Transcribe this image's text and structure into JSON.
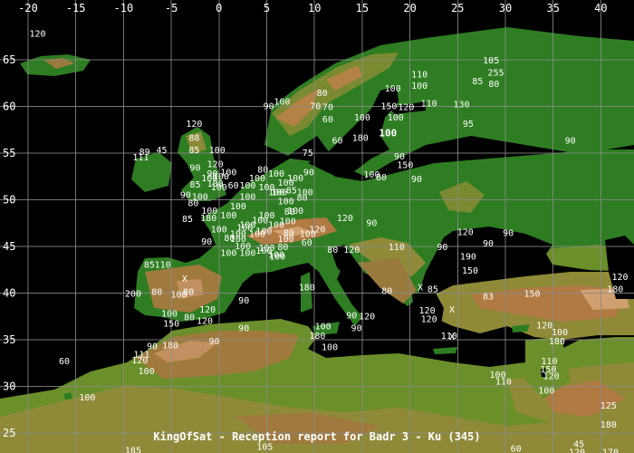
{
  "map": {
    "title": "KingOfSat - Reception report for Badr 3 - Ku (345)",
    "lon_ticks": [
      "-20",
      "-15",
      "-10",
      "-5",
      "0",
      "5",
      "10",
      "15",
      "20",
      "25",
      "30",
      "35",
      "40"
    ],
    "lat_ticks": [
      "65",
      "60",
      "55",
      "50",
      "45",
      "40",
      "35",
      "30",
      "25"
    ],
    "colors": {
      "sea": "#000000",
      "lowland": "#1f7a1f",
      "hill": "#6b8f2a",
      "highland": "#9c7b3a",
      "mountain": "#b07a4a",
      "peak": "#d0a070",
      "ice": "#e0e0e0",
      "grid": "#8a8a8a"
    },
    "reports": [
      {
        "v": "120",
        "lon": -19,
        "lat": 67.5
      },
      {
        "v": "105",
        "lon": 28.5,
        "lat": 64.6
      },
      {
        "v": "255",
        "lon": 29,
        "lat": 63.3
      },
      {
        "v": "110",
        "lon": 21,
        "lat": 63.1
      },
      {
        "v": "85",
        "lon": 27.1,
        "lat": 62.4
      },
      {
        "v": "80",
        "lon": 28.8,
        "lat": 62.1
      },
      {
        "v": "100",
        "lon": 18.2,
        "lat": 61.6
      },
      {
        "v": "100",
        "lon": 21,
        "lat": 61.9
      },
      {
        "v": "80",
        "lon": 10.8,
        "lat": 61.1
      },
      {
        "v": "100",
        "lon": 6.6,
        "lat": 60.2
      },
      {
        "v": "90",
        "lon": 5.2,
        "lat": 59.7
      },
      {
        "v": "70",
        "lon": 10.1,
        "lat": 59.7
      },
      {
        "v": "70",
        "lon": 11.4,
        "lat": 59.6
      },
      {
        "v": "150",
        "lon": 17.8,
        "lat": 59.7
      },
      {
        "v": "120",
        "lon": 19.6,
        "lat": 59.6
      },
      {
        "v": "110",
        "lon": 22,
        "lat": 60
      },
      {
        "v": "130",
        "lon": 25.4,
        "lat": 59.9
      },
      {
        "v": "60",
        "lon": 11.4,
        "lat": 58.3
      },
      {
        "v": "100",
        "lon": 15,
        "lat": 58.5
      },
      {
        "v": "100",
        "lon": 18.5,
        "lat": 58.5
      },
      {
        "v": "100",
        "lon": 17.7,
        "lat": 56.8,
        "b": 1
      },
      {
        "v": "95",
        "lon": 26.1,
        "lat": 57.8
      },
      {
        "v": "90",
        "lon": 36.8,
        "lat": 56
      },
      {
        "v": "120",
        "lon": -2.6,
        "lat": 57.8
      },
      {
        "v": "88",
        "lon": -2.6,
        "lat": 56.3
      },
      {
        "v": "60",
        "lon": 12.4,
        "lat": 56
      },
      {
        "v": "180",
        "lon": 14.8,
        "lat": 56.3
      },
      {
        "v": "89",
        "lon": -7.8,
        "lat": 54.8
      },
      {
        "v": "45",
        "lon": -6,
        "lat": 55
      },
      {
        "v": "85",
        "lon": -2.6,
        "lat": 55
      },
      {
        "v": "100",
        "lon": -0.2,
        "lat": 55
      },
      {
        "v": "75",
        "lon": 9.3,
        "lat": 54.7
      },
      {
        "v": "90",
        "lon": 18.9,
        "lat": 54.3
      },
      {
        "v": "111",
        "lon": -8.2,
        "lat": 54.2
      },
      {
        "v": "120",
        "lon": -0.4,
        "lat": 53.5
      },
      {
        "v": "90",
        "lon": -2.5,
        "lat": 53.1
      },
      {
        "v": "150",
        "lon": 19.5,
        "lat": 53.4
      },
      {
        "v": "90",
        "lon": 9.4,
        "lat": 52.6
      },
      {
        "v": "100",
        "lon": 16,
        "lat": 52.4
      },
      {
        "v": "80",
        "lon": 17,
        "lat": 52.1
      },
      {
        "v": "90",
        "lon": 20.7,
        "lat": 51.9
      },
      {
        "v": "85",
        "lon": -2.5,
        "lat": 51.3
      },
      {
        "v": "90",
        "lon": -3.5,
        "lat": 50.2
      },
      {
        "v": "100",
        "lon": -0.4,
        "lat": 51.4
      },
      {
        "v": "60",
        "lon": 1.5,
        "lat": 51.2
      },
      {
        "v": "90",
        "lon": -0.7,
        "lat": 52.5
      },
      {
        "v": "100",
        "lon": 0.2,
        "lat": 52.2
      },
      {
        "v": "80",
        "lon": 4.6,
        "lat": 52.9
      },
      {
        "v": "85",
        "lon": 7.6,
        "lat": 50.7
      },
      {
        "v": "100",
        "lon": 6.3,
        "lat": 50.5
      },
      {
        "v": "80",
        "lon": 8.7,
        "lat": 49.9
      },
      {
        "v": "80",
        "lon": -2.7,
        "lat": 49.3
      },
      {
        "v": "85",
        "lon": -3.3,
        "lat": 47.6
      },
      {
        "v": "180",
        "lon": -1.1,
        "lat": 47.7
      },
      {
        "v": "100",
        "lon": 4.3,
        "lat": 47.5
      },
      {
        "v": "100",
        "lon": 7.2,
        "lat": 47.4
      },
      {
        "v": "80",
        "lon": 7.4,
        "lat": 48.4
      },
      {
        "v": "120",
        "lon": 13.2,
        "lat": 47.7
      },
      {
        "v": "90",
        "lon": 16,
        "lat": 47.2
      },
      {
        "v": "120",
        "lon": 10.3,
        "lat": 46.5
      },
      {
        "v": "100",
        "lon": 4.7,
        "lat": 46.3
      },
      {
        "v": "80",
        "lon": 7.3,
        "lat": 46.1
      },
      {
        "v": "100",
        "lon": 9.3,
        "lat": 46
      },
      {
        "v": "100",
        "lon": 2.7,
        "lat": 46.7
      },
      {
        "v": "80",
        "lon": 1.1,
        "lat": 45.6
      },
      {
        "v": "60",
        "lon": 9.2,
        "lat": 45.1
      },
      {
        "v": "90",
        "lon": -1.3,
        "lat": 45.2
      },
      {
        "v": "100",
        "lon": 2.5,
        "lat": 44.7
      },
      {
        "v": "80",
        "lon": 6.7,
        "lat": 44.6
      },
      {
        "v": "100",
        "lon": 4.7,
        "lat": 44.2
      },
      {
        "v": "80",
        "lon": 11.9,
        "lat": 44.3
      },
      {
        "v": "120",
        "lon": 13.9,
        "lat": 44.3
      },
      {
        "v": "110",
        "lon": 18.6,
        "lat": 44.6
      },
      {
        "v": "90",
        "lon": 23.4,
        "lat": 44.6
      },
      {
        "v": "120",
        "lon": 25.8,
        "lat": 46.2
      },
      {
        "v": "90",
        "lon": 28.2,
        "lat": 45
      },
      {
        "v": "90",
        "lon": 30.3,
        "lat": 46.1
      },
      {
        "v": "190",
        "lon": 26.1,
        "lat": 43.6
      },
      {
        "v": "150",
        "lon": 26.3,
        "lat": 42.1
      },
      {
        "v": "100",
        "lon": 6.1,
        "lat": 43.6
      },
      {
        "v": "85",
        "lon": -7.3,
        "lat": 42.7
      },
      {
        "v": "110",
        "lon": -5.9,
        "lat": 42.7
      },
      {
        "v": "X",
        "lon": -3.6,
        "lat": 41.2
      },
      {
        "v": "80",
        "lon": -3.2,
        "lat": 39.8
      },
      {
        "v": "200",
        "lon": -9,
        "lat": 39.6
      },
      {
        "v": "80",
        "lon": -6.5,
        "lat": 39.8
      },
      {
        "v": "100",
        "lon": -4.2,
        "lat": 39.5
      },
      {
        "v": "90",
        "lon": 2.6,
        "lat": 38.9
      },
      {
        "v": "180",
        "lon": 9.2,
        "lat": 40.3
      },
      {
        "v": "80",
        "lon": 17.6,
        "lat": 39.9
      },
      {
        "v": "85",
        "lon": 22.4,
        "lat": 40.1
      },
      {
        "v": "X",
        "lon": 21.1,
        "lat": 40.3
      },
      {
        "v": "83",
        "lon": 28.2,
        "lat": 39.3
      },
      {
        "v": "150",
        "lon": 32.8,
        "lat": 39.6
      },
      {
        "v": "180",
        "lon": 41.5,
        "lat": 40.1
      },
      {
        "v": "120",
        "lon": 42,
        "lat": 41.4
      },
      {
        "v": "120",
        "lon": -1.2,
        "lat": 37.9
      },
      {
        "v": "120",
        "lon": 21.8,
        "lat": 37.8
      },
      {
        "v": "X",
        "lon": 24.4,
        "lat": 37.9
      },
      {
        "v": "120",
        "lon": 22,
        "lat": 36.9
      },
      {
        "v": "100",
        "lon": -5.2,
        "lat": 37.5
      },
      {
        "v": "150",
        "lon": -5,
        "lat": 36.4
      },
      {
        "v": "80",
        "lon": -3.1,
        "lat": 37.1
      },
      {
        "v": "120",
        "lon": -1.5,
        "lat": 36.7
      },
      {
        "v": "90",
        "lon": 13.9,
        "lat": 37.3
      },
      {
        "v": "120",
        "lon": 15.5,
        "lat": 37.2
      },
      {
        "v": "90",
        "lon": 2.6,
        "lat": 35.9
      },
      {
        "v": "90",
        "lon": 14.4,
        "lat": 35.9
      },
      {
        "v": "100",
        "lon": 10.9,
        "lat": 36.1
      },
      {
        "v": "180",
        "lon": 10.3,
        "lat": 35.1
      },
      {
        "v": "100",
        "lon": 11.6,
        "lat": 33.9
      },
      {
        "v": "120",
        "lon": 34.1,
        "lat": 36.2
      },
      {
        "v": "100",
        "lon": 35.7,
        "lat": 35.5
      },
      {
        "v": "X",
        "lon": 24.4,
        "lat": 35
      },
      {
        "v": "110",
        "lon": 24.1,
        "lat": 35.1
      },
      {
        "v": "180",
        "lon": 35.4,
        "lat": 34.5
      },
      {
        "v": "90",
        "lon": -0.5,
        "lat": 34.5
      },
      {
        "v": "180",
        "lon": -5.1,
        "lat": 34.1
      },
      {
        "v": "90",
        "lon": -7,
        "lat": 34
      },
      {
        "v": "120",
        "lon": -8.3,
        "lat": 32.5
      },
      {
        "v": "111",
        "lon": -8.1,
        "lat": 33.1
      },
      {
        "v": "100",
        "lon": -7.6,
        "lat": 31.3
      },
      {
        "v": "60",
        "lon": -16.2,
        "lat": 32.4
      },
      {
        "v": "110",
        "lon": 34.6,
        "lat": 32.4
      },
      {
        "v": "150",
        "lon": 34.5,
        "lat": 31.5
      },
      {
        "v": "120",
        "lon": 34.8,
        "lat": 30.8
      },
      {
        "v": "100",
        "lon": 29.2,
        "lat": 30.9
      },
      {
        "v": "110",
        "lon": 29.8,
        "lat": 30.2
      },
      {
        "v": "100",
        "lon": 34.3,
        "lat": 29.2
      },
      {
        "v": "100",
        "lon": -13.8,
        "lat": 28.5
      },
      {
        "v": "125",
        "lon": 40.8,
        "lat": 27.6
      },
      {
        "v": "180",
        "lon": 40.8,
        "lat": 25.6
      },
      {
        "v": "45",
        "lon": 37.7,
        "lat": 23.5
      },
      {
        "v": "105",
        "lon": 4.8,
        "lat": 23.2
      },
      {
        "v": "185",
        "lon": -9,
        "lat": 22.8
      },
      {
        "v": "60",
        "lon": 31.1,
        "lat": 23
      },
      {
        "v": "120",
        "lon": 37.5,
        "lat": 22.6
      },
      {
        "v": "170",
        "lon": 41,
        "lat": 22.6
      }
    ]
  }
}
